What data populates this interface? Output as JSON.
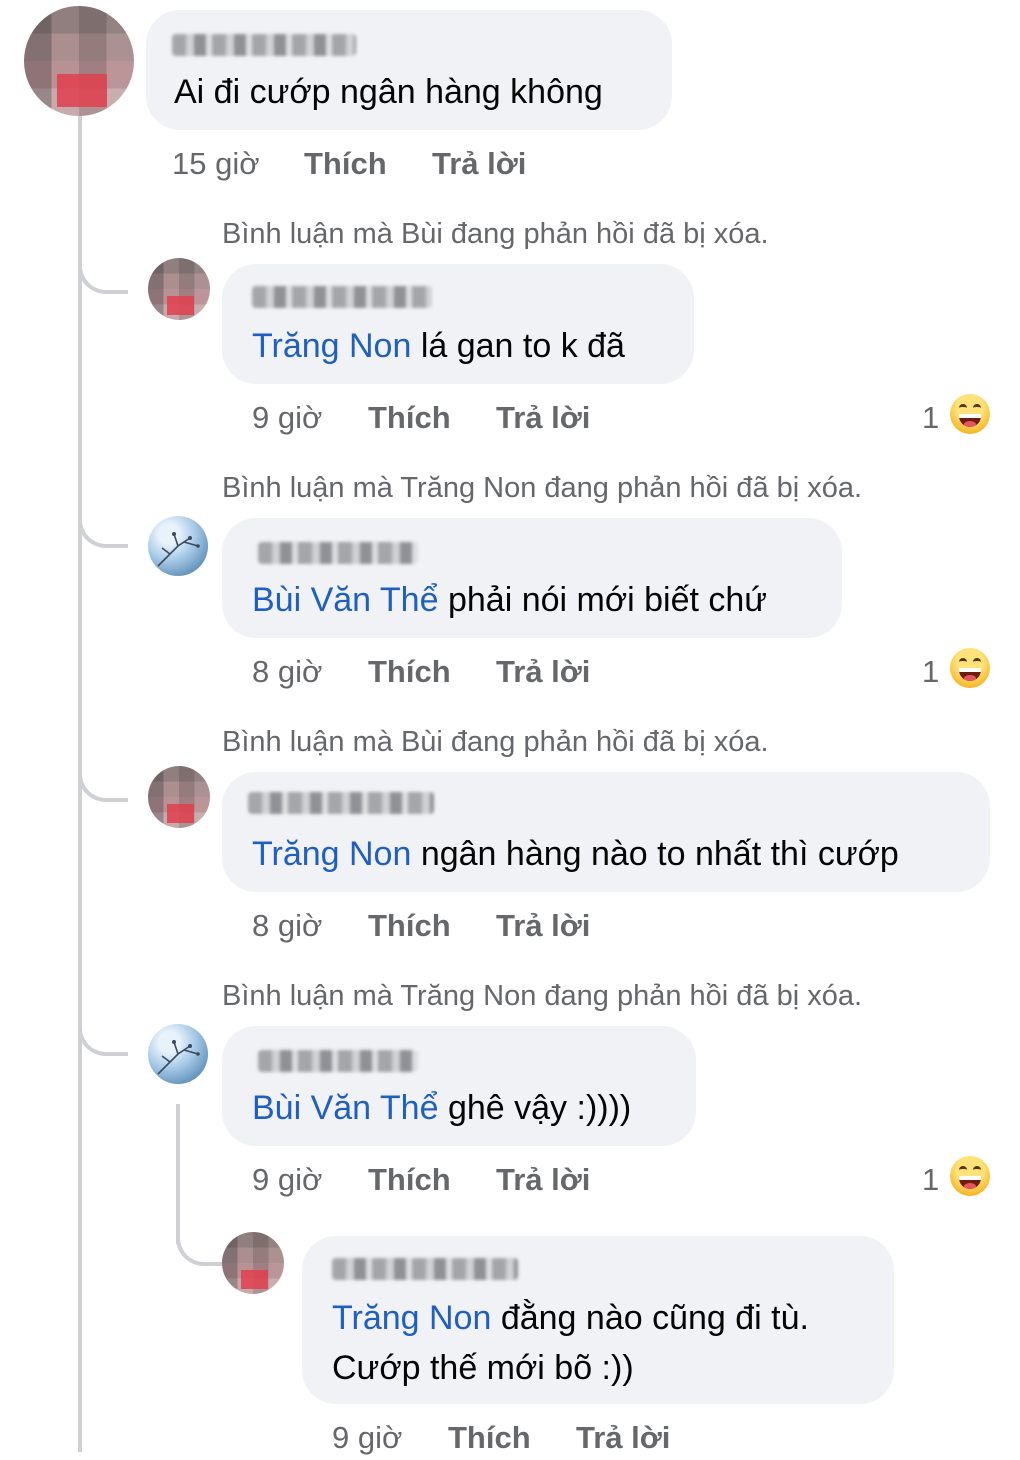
{
  "comments": [
    {
      "text": "Ai đi cướp ngân hàng không",
      "time": "15 giờ",
      "like": "Thích",
      "reply": "Trả lời"
    },
    {
      "deleted_notice": "Bình luận mà Bùi đang phản hồi đã bị xóa.",
      "mention": "Trăng Non",
      "text": " lá gan to k đã",
      "time": "9 giờ",
      "like": "Thích",
      "reply": "Trả lời",
      "reaction_count": "1"
    },
    {
      "deleted_notice": "Bình luận mà Trăng Non đang phản hồi đã bị xóa.",
      "mention": "Bùi Văn Thể",
      "text": " phải nói mới biết chứ",
      "time": "8 giờ",
      "like": "Thích",
      "reply": "Trả lời",
      "reaction_count": "1"
    },
    {
      "deleted_notice": "Bình luận mà Bùi đang phản hồi đã bị xóa.",
      "mention": "Trăng Non",
      "text": " ngân hàng nào to nhất thì cướp",
      "time": "8 giờ",
      "like": "Thích",
      "reply": "Trả lời"
    },
    {
      "deleted_notice": "Bình luận mà Trăng Non đang phản hồi đã bị xóa.",
      "mention": "Bùi Văn Thể",
      "text": " ghê vậy :))))",
      "time": "9 giờ",
      "like": "Thích",
      "reply": "Trả lời",
      "reaction_count": "1"
    },
    {
      "mention": "Trăng Non",
      "text": " đằng nào cũng đi tù.",
      "text_line2": "Cướp thế mới bõ :))",
      "time": "9 giờ",
      "like": "Thích",
      "reply": "Trả lời"
    }
  ],
  "icons": {
    "reaction": "haha-emoji-icon"
  },
  "colors": {
    "mention": "#1e5fbf",
    "bubble": "#f0f2f5",
    "meta_text": "#65676b"
  }
}
